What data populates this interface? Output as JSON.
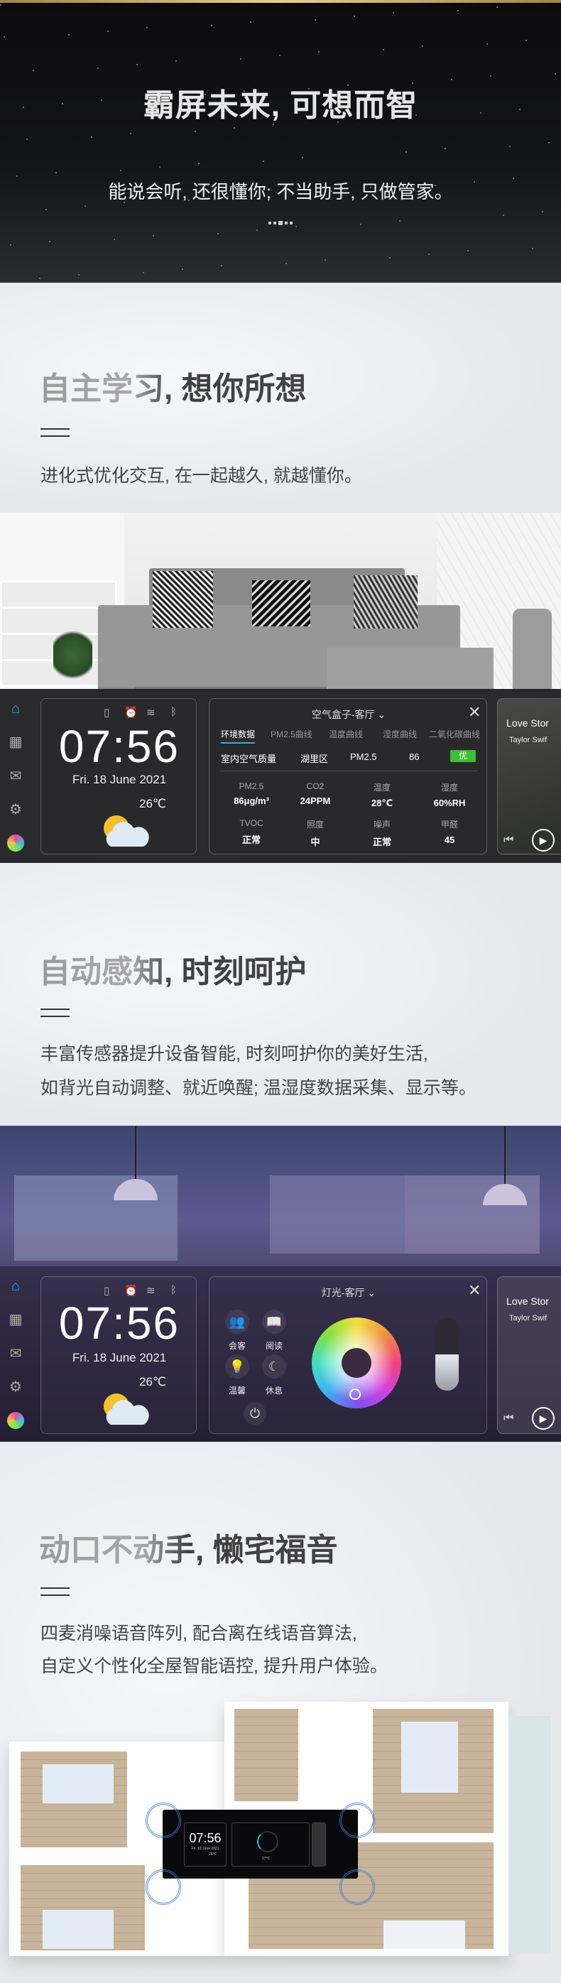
{
  "hero": {
    "title": "霸屏未来, 可想而智",
    "subtitle": "能说会听, 还很懂你; 不当助手, 只做管家。"
  },
  "sections": [
    {
      "title": "自主学习, 想你所想",
      "lines": [
        "进化式优化交互, 在一起越久, 就越懂你。"
      ]
    },
    {
      "title": "自动感知, 时刻呵护",
      "lines": [
        "丰富传感器提升设备智能, 时刻呵护你的美好生活,",
        "如背光自动调整、就近唤醒; 温湿度数据采集、显示等。"
      ]
    },
    {
      "title": "动口不动手, 懒宅福音",
      "lines": [
        "四麦消噪语音阵列, 配合离在线语音算法,",
        "自定义个性化全屋智能语控, 提升用户体验。"
      ]
    }
  ],
  "clock": {
    "time": "07:56",
    "date": "Fri. 18 June  2021",
    "temperature": "26℃",
    "weather_icon": "partly-cloudy-icon",
    "status_icons": [
      "phone-icon",
      "alarm-icon",
      "wifi-icon",
      "bluetooth-icon"
    ]
  },
  "sidebar": {
    "icons": [
      "home-icon",
      "apps-icon",
      "message-icon",
      "settings-icon",
      "voice-assistant-icon"
    ],
    "accent": "#29b6e0"
  },
  "air_panel": {
    "title": "空气盒子-客厅 ⌄",
    "tabs": [
      "环境数据",
      "PM2.5曲线",
      "温度曲线",
      "湿度曲线",
      "二氧化碳曲线"
    ],
    "summary": {
      "label": "室内空气质量",
      "district": "湖里区",
      "metric": "PM2.5",
      "value": "86",
      "grade": "优",
      "grade_color": "#3fbf34"
    },
    "readings": [
      {
        "label": "PM2.5",
        "value": "86μg/m³"
      },
      {
        "label": "CO2",
        "value": "24PPM"
      },
      {
        "label": "温度",
        "value": "28℃"
      },
      {
        "label": "湿度",
        "value": "60%RH"
      },
      {
        "label": "TVOC",
        "value": "正常"
      },
      {
        "label": "照度",
        "value": "中"
      },
      {
        "label": "噪声",
        "value": "正常"
      },
      {
        "label": "甲醛",
        "value": "45"
      }
    ]
  },
  "light_panel": {
    "title": "灯光-客厅 ⌄",
    "scenes": [
      {
        "label": "会客",
        "icon": "guests-icon"
      },
      {
        "label": "阅读",
        "icon": "book-icon"
      },
      {
        "label": "温馨",
        "icon": "bulb-icon"
      },
      {
        "label": "休息",
        "icon": "moon-sleep-icon"
      }
    ],
    "brightness_percent": 50
  },
  "music": {
    "title": "Love Stor",
    "artist": "Taylor Swif"
  },
  "floor_device": {
    "time": "07:56",
    "date": "Fri. 18 June 2021",
    "temperature": "26℃",
    "ac_temperature": "27℃"
  }
}
